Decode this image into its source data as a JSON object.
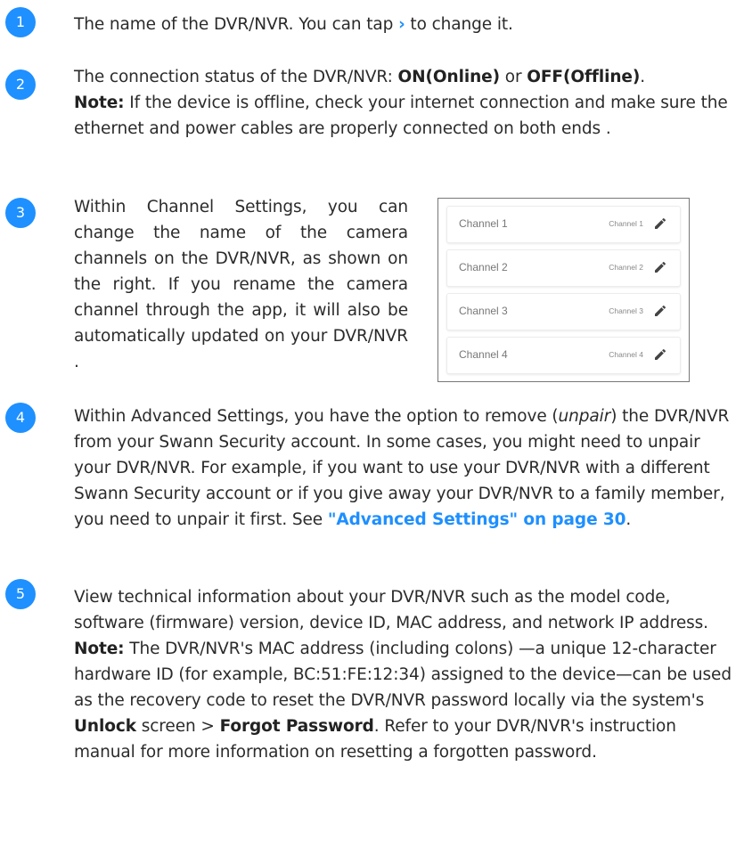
{
  "accent_color": "#1e90ff",
  "items": [
    {
      "number": "1",
      "text_before": "The name of the DVR/NVR. You can tap ",
      "chevron": "›",
      "text_after": " to change it."
    },
    {
      "number": "2",
      "line1_before": "The connection status of the DVR/NVR: ",
      "on_label": "ON(Online)",
      "line1_middle": " or ",
      "off_label": "OFF(Offline)",
      "line1_end": ".",
      "note_label": "Note:",
      "note_text": " If the device is offline, check your internet connection and make sure the ethernet and power cables are properly connected on both ends ."
    },
    {
      "number": "3",
      "text": "Within Channel Settings, you can change the name of the camera channels on the DVR/NVR, as shown on the right. If you rename the camera channel through the app, it will also be automatically updated on your DVR/NVR ."
    },
    {
      "number": "4",
      "text_a": "Within Advanced Settings, you have the option to remove (",
      "italic": "unpair",
      "text_b": ") the DVR/NVR from your Swann Security account. In some cases, you might need to unpair your DVR/NVR. For example, if you want to use your DVR/NVR with a different Swann Security account or if you give away your DVR/NVR to a family member, you need to unpair it first. See ",
      "link": "\"Advanced Settings\" on page 30",
      "text_c": "."
    },
    {
      "number": "5",
      "text": "View technical information about your DVR/NVR such as the model code, software (firmware) version, device ID, MAC address, and network IP address.",
      "note_label": "Note:",
      "note_a": " The DVR/NVR's MAC address (including colons) —a unique 12-character hardware ID (for example, BC:51:FE:12:34) assigned to the device—can be used as the recovery code to reset the DVR/NVR password locally via the system's ",
      "unlock": "Unlock",
      "note_b": " screen > ",
      "forgot": "Forgot Password",
      "note_c": ". Refer to your DVR/NVR's instruction manual for more information on resetting a forgotten password."
    }
  ],
  "channels": [
    {
      "name": "Channel 1",
      "value": "Channel 1",
      "icon": "pencil-icon"
    },
    {
      "name": "Channel 2",
      "value": "Channel 2",
      "icon": "pencil-icon"
    },
    {
      "name": "Channel 3",
      "value": "Channel 3",
      "icon": "pencil-icon"
    },
    {
      "name": "Channel 4",
      "value": "Channel 4",
      "icon": "pencil-icon"
    }
  ]
}
